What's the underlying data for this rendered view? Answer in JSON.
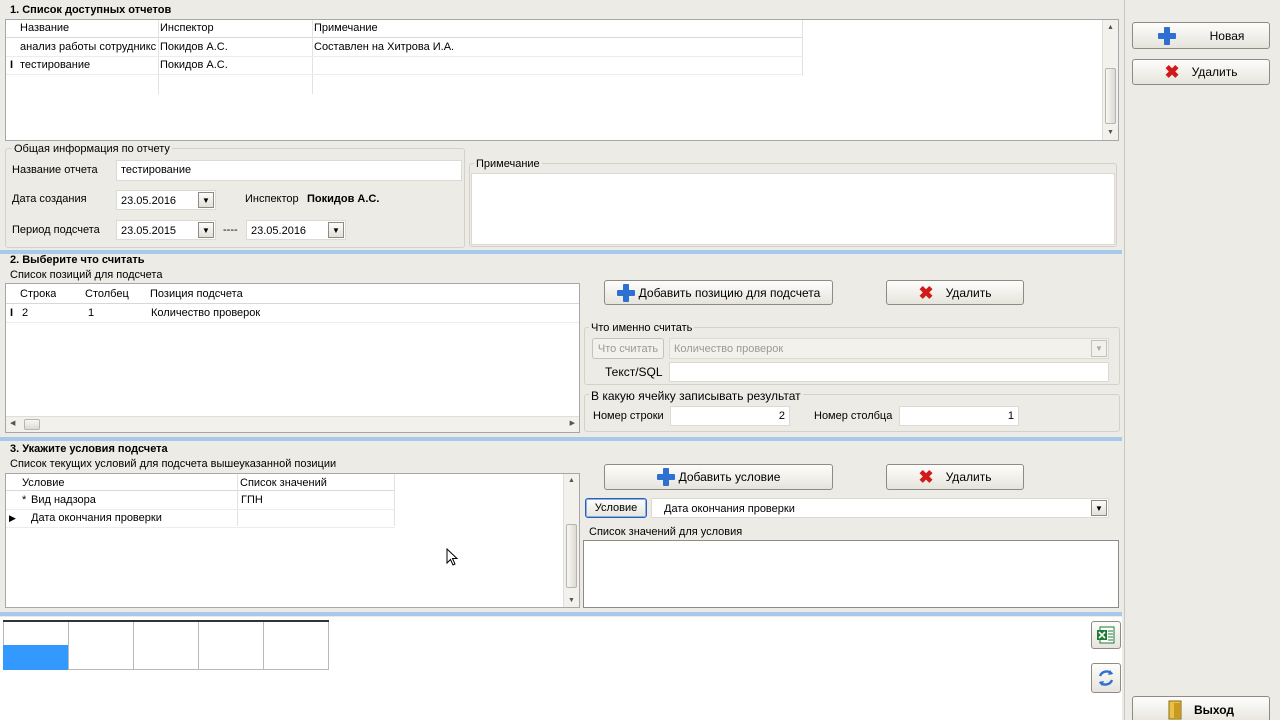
{
  "section1": {
    "title": "1. Список доступных отчетов",
    "columns": [
      "Название",
      "Инспектор",
      "Примечание"
    ],
    "rows": [
      {
        "name": "анализ работы сотрудникс",
        "inspector": "Покидов А.С.",
        "note": "Составлен на Хитрова И.А.",
        "marker": ""
      },
      {
        "name": "тестирование",
        "inspector": "Покидов А.С.",
        "note": "",
        "marker": "I"
      }
    ]
  },
  "general": {
    "group_title": "Общая информация по отчету",
    "report_name_label": "Название отчета",
    "report_name_value": "тестирование",
    "created_label": "Дата создания",
    "created_value": "23.05.2016",
    "inspector_label": "Инспектор",
    "inspector_value": "Покидов А.С.",
    "period_label": "Период подсчета",
    "period_from": "23.05.2015",
    "period_sep": "----",
    "period_to": "23.05.2016",
    "note_label": "Примечание"
  },
  "right_panel": {
    "new_label": "Новая",
    "delete_label": "Удалить",
    "exit_label": "Выход"
  },
  "section2": {
    "title": "2. Выберите что считать",
    "list_title": "Список позиций для подсчета",
    "columns": [
      "Строка",
      "Столбец",
      "Позиция подсчета"
    ],
    "rows": [
      {
        "row": "2",
        "col": "1",
        "position": "Количество проверок",
        "marker": "I"
      }
    ],
    "add_label": "Добавить позицию для подсчета",
    "delete_label": "Удалить",
    "what_group": "Что именно считать",
    "what_button": "Что считать",
    "what_value": "Количество проверок",
    "text_sql_label": "Текст/SQL",
    "cell_group": "В какую ячейку записывать результат",
    "row_num_label": "Номер строки",
    "row_num_value": "2",
    "col_num_label": "Номер столбца",
    "col_num_value": "1"
  },
  "section3": {
    "title": "3. Укажите условия подсчета",
    "list_title": "Список текущих условий для подсчета вышеуказанной позиции",
    "columns": [
      "Условие",
      "Список значений"
    ],
    "rows": [
      {
        "marker": "*",
        "condition": "Вид надзора",
        "values": "ГПН"
      },
      {
        "marker": "▶",
        "condition": "Дата окончания проверки",
        "values": ""
      }
    ],
    "add_label": "Добавить условие",
    "delete_label": "Удалить",
    "condition_button": "Условие",
    "condition_value": "Дата окончания проверки",
    "values_group": "Список значений для условия"
  },
  "icons": {
    "excel": "excel-icon",
    "refresh": "refresh-icon",
    "exit": "exit-door-icon"
  },
  "colors": {
    "accent_blue": "#3399ff",
    "separator_blue": "#a9c9ec",
    "delete_red": "#d11a1a",
    "add_blue": "#2e6fd2"
  }
}
